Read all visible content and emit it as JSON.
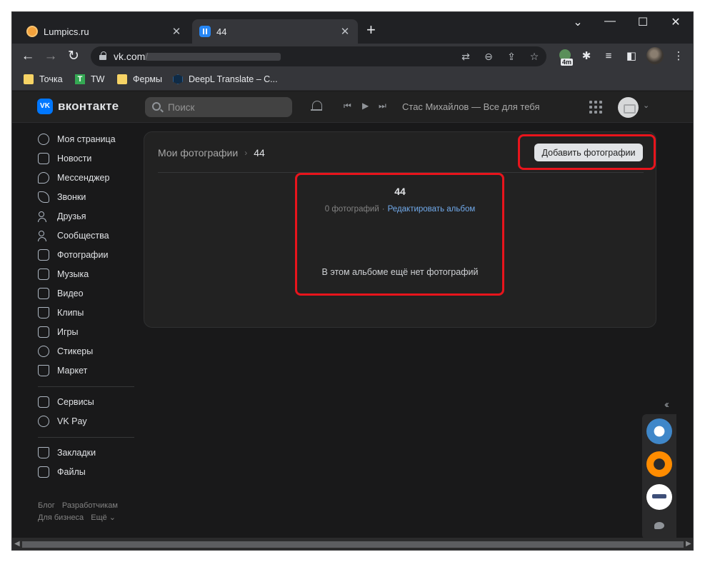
{
  "browser": {
    "tabs": [
      {
        "title": "Lumpics.ru",
        "close": "✕"
      },
      {
        "title": "44",
        "close": "✕"
      }
    ],
    "new_tab": "+",
    "window_controls": {
      "tab_search": "⌄",
      "minimize": "—",
      "maximize": "☐",
      "close": "✕"
    },
    "nav": {
      "back": "←",
      "forward": "→",
      "reload": "↻"
    },
    "url": "vk.com/",
    "extension_badge": "4m",
    "bookmarks": [
      "Точка",
      "TW",
      "Фермы",
      "DeepL Translate – С..."
    ]
  },
  "vk": {
    "logo": "вконтакте",
    "logo_mark": "VK",
    "search_placeholder": "Поиск",
    "now_playing": "Стас Михайлов — Все для тебя",
    "sidebar": {
      "main": [
        {
          "label": "Моя страница",
          "icon": "user-circle-icon"
        },
        {
          "label": "Новости",
          "icon": "news-icon"
        },
        {
          "label": "Мессенджер",
          "icon": "message-icon"
        },
        {
          "label": "Звонки",
          "icon": "phone-icon"
        },
        {
          "label": "Друзья",
          "icon": "friends-icon"
        },
        {
          "label": "Сообщества",
          "icon": "communities-icon"
        },
        {
          "label": "Фотографии",
          "icon": "photos-icon"
        },
        {
          "label": "Музыка",
          "icon": "music-icon"
        },
        {
          "label": "Видео",
          "icon": "video-icon"
        },
        {
          "label": "Клипы",
          "icon": "clips-icon"
        },
        {
          "label": "Игры",
          "icon": "games-icon"
        },
        {
          "label": "Стикеры",
          "icon": "stickers-icon"
        },
        {
          "label": "Маркет",
          "icon": "market-icon"
        }
      ],
      "services": [
        {
          "label": "Сервисы",
          "icon": "services-icon"
        },
        {
          "label": "VK Pay",
          "icon": "vkpay-icon"
        }
      ],
      "personal": [
        {
          "label": "Закладки",
          "icon": "bookmark-icon"
        },
        {
          "label": "Файлы",
          "icon": "file-icon"
        }
      ],
      "footer": [
        "Блог",
        "Разработчикам",
        "Для бизнеса",
        "Ещё ⌄"
      ]
    },
    "album": {
      "breadcrumb_parent": "Мои фотографии",
      "breadcrumb_separator": "›",
      "breadcrumb_current": "44",
      "add_button": "Добавить фотографии",
      "title": "44",
      "photo_count": "0 фотографий",
      "meta_separator": "·",
      "edit_link": "Редактировать альбом",
      "empty_message": "В этом альбоме ещё нет фотографий"
    },
    "colors": {
      "accent": "#0077ff",
      "link": "#71aaeb",
      "highlight": "#e8141c"
    }
  }
}
